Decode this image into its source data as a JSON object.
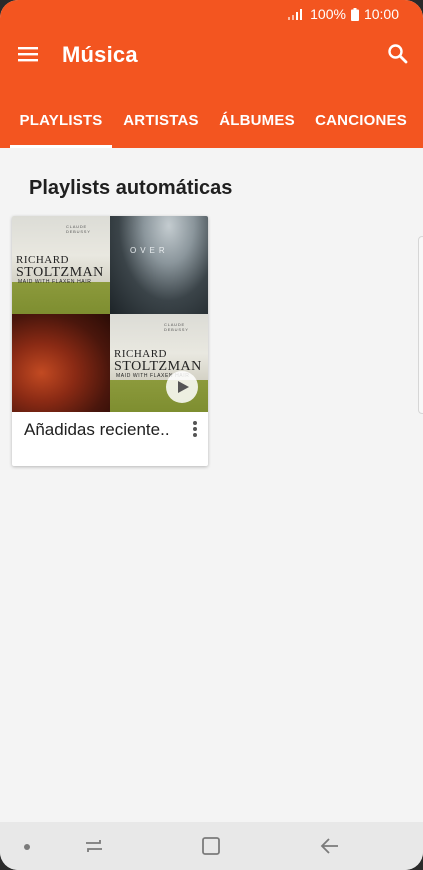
{
  "status_bar": {
    "battery": "100%",
    "time": "10:00"
  },
  "app_bar": {
    "title": "Música",
    "menu_icon": "hamburger-menu-icon",
    "search_icon": "search-icon"
  },
  "tabs": [
    {
      "label": "PLAYLISTS",
      "active": true
    },
    {
      "label": "ARTISTAS",
      "active": false
    },
    {
      "label": "ÁLBUMES",
      "active": false
    },
    {
      "label": "CANCIONES",
      "active": false
    }
  ],
  "section": {
    "title": "Playlists automáticas"
  },
  "playlist_card": {
    "label": "Añadidas reciente..",
    "artwork": {
      "richard_first": "RICHARD",
      "stoltzman": "STOLTZMAN",
      "subtitle": "MAID WITH FLAXEN HAIR",
      "mountain_text": "OVER"
    }
  },
  "colors": {
    "primary": "#f35520",
    "background": "#f4f4f4",
    "nav_bar": "#e8e8e8"
  }
}
